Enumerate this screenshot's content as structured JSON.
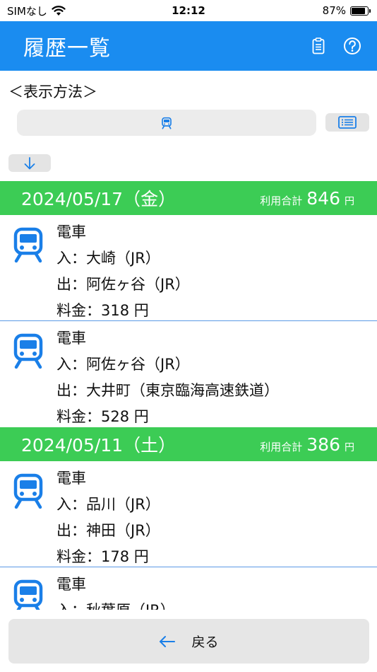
{
  "status": {
    "carrier": "SIMなし",
    "time": "12:12",
    "battery": "87%",
    "battery_level": 0.87
  },
  "header": {
    "title": "履歴一覧",
    "icons": [
      "clipboard-icon",
      "help-icon"
    ]
  },
  "display": {
    "label": "＜表示方法＞",
    "mode_icon": "train-icon",
    "list_icon": "list-icon",
    "sort_icon": "arrow-down-icon"
  },
  "groups": [
    {
      "date": "2024/05/17（金）",
      "total_label": "利用合計",
      "total_amount": "846",
      "total_unit": "円",
      "rides": [
        {
          "type": "電車",
          "entry": "入：大崎（JR）",
          "exit": "出：阿佐ヶ谷（JR）",
          "fare": "料金：318 円"
        },
        {
          "type": "電車",
          "entry": "入：阿佐ヶ谷（JR）",
          "exit": "出：大井町（東京臨海高速鉄道）",
          "fare": "料金：528 円"
        }
      ]
    },
    {
      "date": "2024/05/11（土）",
      "total_label": "利用合計",
      "total_amount": "386",
      "total_unit": "円",
      "rides": [
        {
          "type": "電車",
          "entry": "入：品川（JR）",
          "exit": "出：神田（JR）",
          "fare": "料金：178 円"
        },
        {
          "type": "電車",
          "entry": "入：秋葉原（JR）",
          "exit": "",
          "fare": ""
        }
      ]
    }
  ],
  "footer": {
    "back_label": "戻る",
    "back_icon": "arrow-left-icon"
  },
  "colors": {
    "accent": "#1a8cf0",
    "date_header": "#3ccc55",
    "icon_blue": "#1a7fe8"
  }
}
